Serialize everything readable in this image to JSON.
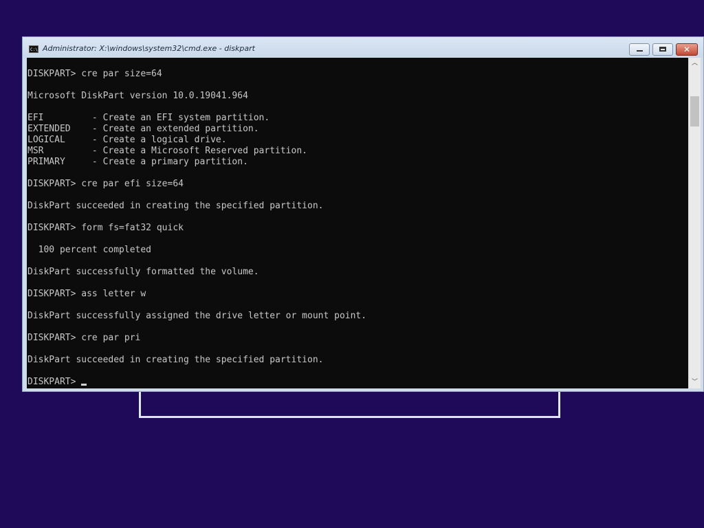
{
  "window": {
    "title": "Administrator: X:\\windows\\system32\\cmd.exe - diskpart",
    "icon": "cmd-icon",
    "icon_text": "C:\\"
  },
  "controls": {
    "minimize": "minimize-icon",
    "maximize": "maximize-icon",
    "close": "close-icon",
    "close_glyph": "✕"
  },
  "console": {
    "lines": [
      "DISKPART> cre par size=64",
      "",
      "Microsoft DiskPart version 10.0.19041.964",
      "",
      "EFI         - Create an EFI system partition.",
      "EXTENDED    - Create an extended partition.",
      "LOGICAL     - Create a logical drive.",
      "MSR         - Create a Microsoft Reserved partition.",
      "PRIMARY     - Create a primary partition.",
      "",
      "DISKPART> cre par efi size=64",
      "",
      "DiskPart succeeded in creating the specified partition.",
      "",
      "DISKPART> form fs=fat32 quick",
      "",
      "  100 percent completed",
      "",
      "DiskPart successfully formatted the volume.",
      "",
      "DISKPART> ass letter w",
      "",
      "DiskPart successfully assigned the drive letter or mount point.",
      "",
      "DISKPART> cre par pri",
      "",
      "DiskPart succeeded in creating the specified partition.",
      ""
    ],
    "prompt": "DISKPART> "
  },
  "scrollbar": {
    "up_glyph": "︿",
    "down_glyph": "﹀"
  },
  "colors": {
    "desktop": "#1f0a5a",
    "console_bg": "#0c0c0c",
    "console_text": "#c8c8c8"
  }
}
